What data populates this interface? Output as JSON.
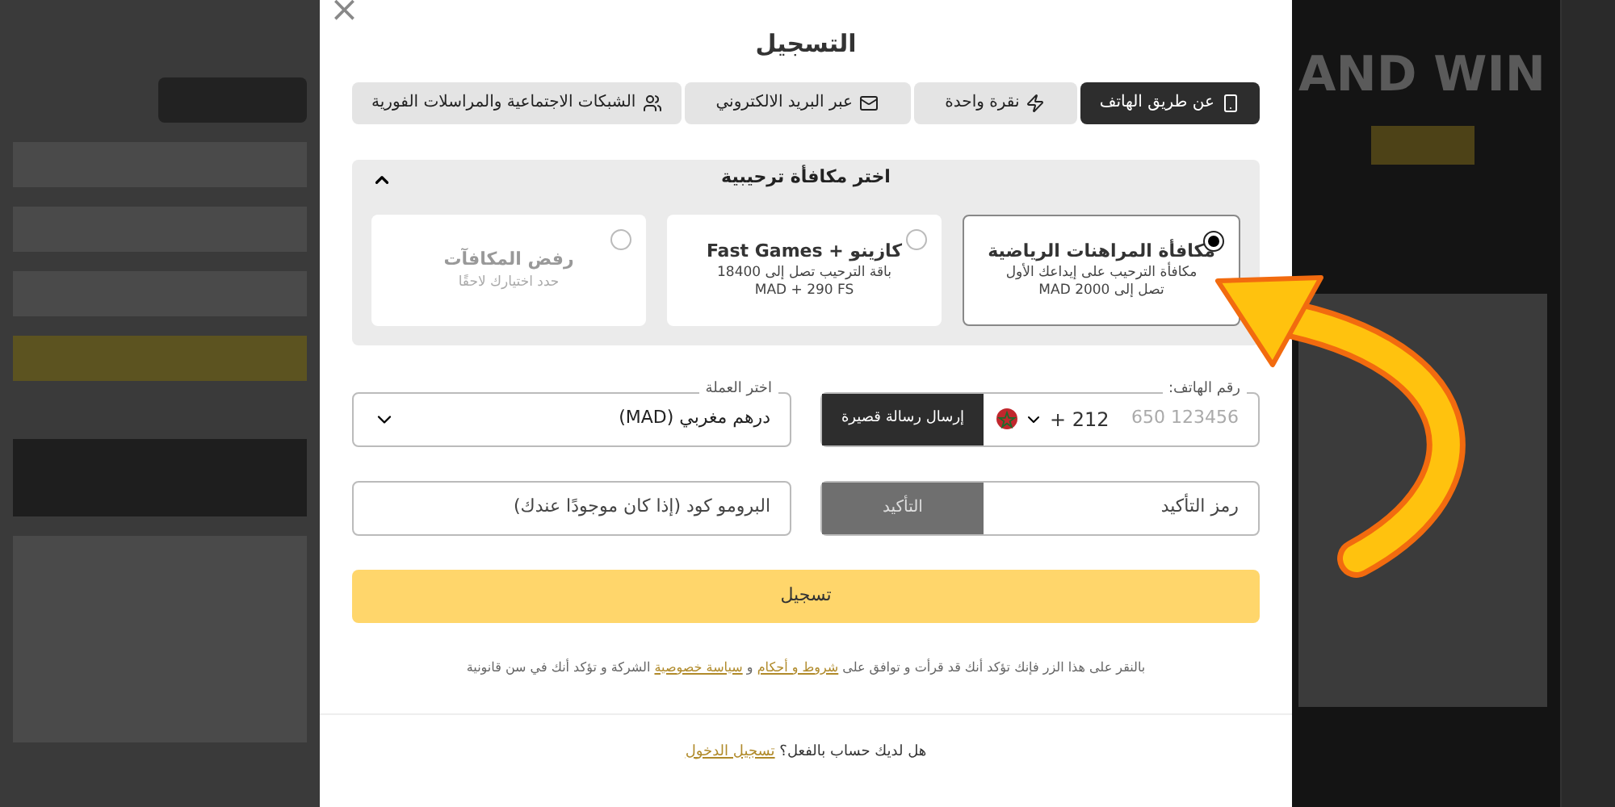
{
  "background": {
    "banner_text": "AND WIN"
  },
  "dialog": {
    "title": "التسجيل",
    "close": "×"
  },
  "tabs": [
    {
      "label": "عن طريق الهاتف",
      "kind": "phone",
      "selected": true
    },
    {
      "label": "نقرة واحدة",
      "kind": "oneclick",
      "selected": false
    },
    {
      "label": "عبر البريد الالكتروني",
      "kind": "email",
      "selected": false
    },
    {
      "label": "الشبكات الاجتماعية والمراسلات الفورية",
      "kind": "social",
      "selected": false
    }
  ],
  "bonus": {
    "title": "اختر مكافأة ترحيبية",
    "expanded": true,
    "options": [
      {
        "title": "مكافأة المراهنات الرياضية",
        "lines": [
          "مكافأة الترحيب على إيداعك الأول",
          "تصل إلى MAD 2000"
        ],
        "muted": false,
        "selected": true
      },
      {
        "title": "كازينو + Fast Games",
        "lines": [
          "باقة الترحيب تصل إلى 18400",
          "MAD + 290 FS"
        ],
        "muted": false,
        "selected": false
      },
      {
        "title": "رفض المكافآت",
        "lines": [
          "حدد اختيارك لاحقًا"
        ],
        "muted": true,
        "selected": false
      }
    ]
  },
  "phone": {
    "label": "رقم الهاتف:",
    "code": "+ 212",
    "placeholder": "650 123456",
    "button": "إرسال رسالة قصيرة"
  },
  "currency": {
    "label": "اختر العملة",
    "value": "درهم مغربي (MAD)"
  },
  "confirm": {
    "placeholder": "رمز التأكيد",
    "button": "التأكيد",
    "disabled": true
  },
  "promo": {
    "placeholder": "البرومو كود (إذا كان موجودًا عندك)"
  },
  "register_button": "تسجيل",
  "terms": {
    "before": "بالنقر على هذا الزر فإنك تؤكد أنك قد قرأت و توافق على",
    "link_1": "شروط و أحكام",
    "middle": "و",
    "link_2": "سياسة خصوصية",
    "after": "الشركة و تؤكد أنك في سن قانونية"
  },
  "footer": {
    "question": "هل لديك حساب بالفعل؟",
    "link": "تسجيل الدخول"
  }
}
